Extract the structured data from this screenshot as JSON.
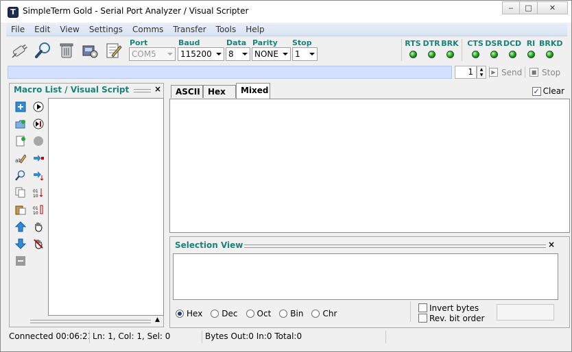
{
  "window": {
    "title": "SimpleTerm Gold - Serial Port Analyzer / Visual Scripter",
    "app_icon_letter": "T"
  },
  "window_controls": {
    "minimize": "‒",
    "maximize": "□",
    "close": "✕"
  },
  "menu": [
    "File",
    "Edit",
    "View",
    "Settings",
    "Comms",
    "Transfer",
    "Tools",
    "Help"
  ],
  "toolbar": {
    "icons": [
      "connect-icon",
      "search-icon",
      "trash-icon",
      "port-settings-icon",
      "edit-script-icon"
    ],
    "port": {
      "label": "Port",
      "value": "COM5"
    },
    "baud": {
      "label": "Baud",
      "value": "115200"
    },
    "data": {
      "label": "Data",
      "value": "8"
    },
    "parity": {
      "label": "Parity",
      "value": "NONE"
    },
    "stop": {
      "label": "Stop",
      "value": "1"
    },
    "output_signals": [
      "RTS",
      "DTR",
      "BRK"
    ],
    "input_signals": [
      "CTS",
      "DSR",
      "DCD",
      "RI",
      "BRKD"
    ],
    "led_color": "#18a018"
  },
  "sendbar": {
    "repeat_value": "1",
    "send_label": "Send",
    "stop_label": "Stop",
    "input_bg": "#d4e0ff"
  },
  "macro_panel": {
    "title": "Macro List / Visual Script",
    "close": "×",
    "scroll_up": "▲"
  },
  "tabs": [
    {
      "label": "ASCII",
      "active": false
    },
    {
      "label": "Hex",
      "active": false
    },
    {
      "label": "Mixed",
      "active": true
    }
  ],
  "clear": {
    "label": "Clear",
    "checked": true,
    "check_glyph": "✓"
  },
  "selection_view": {
    "title": "Selection View",
    "close": "×",
    "radix": [
      {
        "label": "Hex",
        "selected": true
      },
      {
        "label": "Dec",
        "selected": false
      },
      {
        "label": "Oct",
        "selected": false
      },
      {
        "label": "Bin",
        "selected": false
      },
      {
        "label": "Chr",
        "selected": false
      }
    ],
    "invert_bytes": "Invert bytes",
    "rev_bit_order": "Rev. bit order"
  },
  "status": {
    "connected": "Connected 00:06:21",
    "position": "Ln: 1, Col: 1, Sel: 0",
    "bytes": "Bytes Out:0  In:0  Total:0"
  },
  "colors": {
    "accent_teal": "#1b8279",
    "title_bg": "#ffffff"
  }
}
